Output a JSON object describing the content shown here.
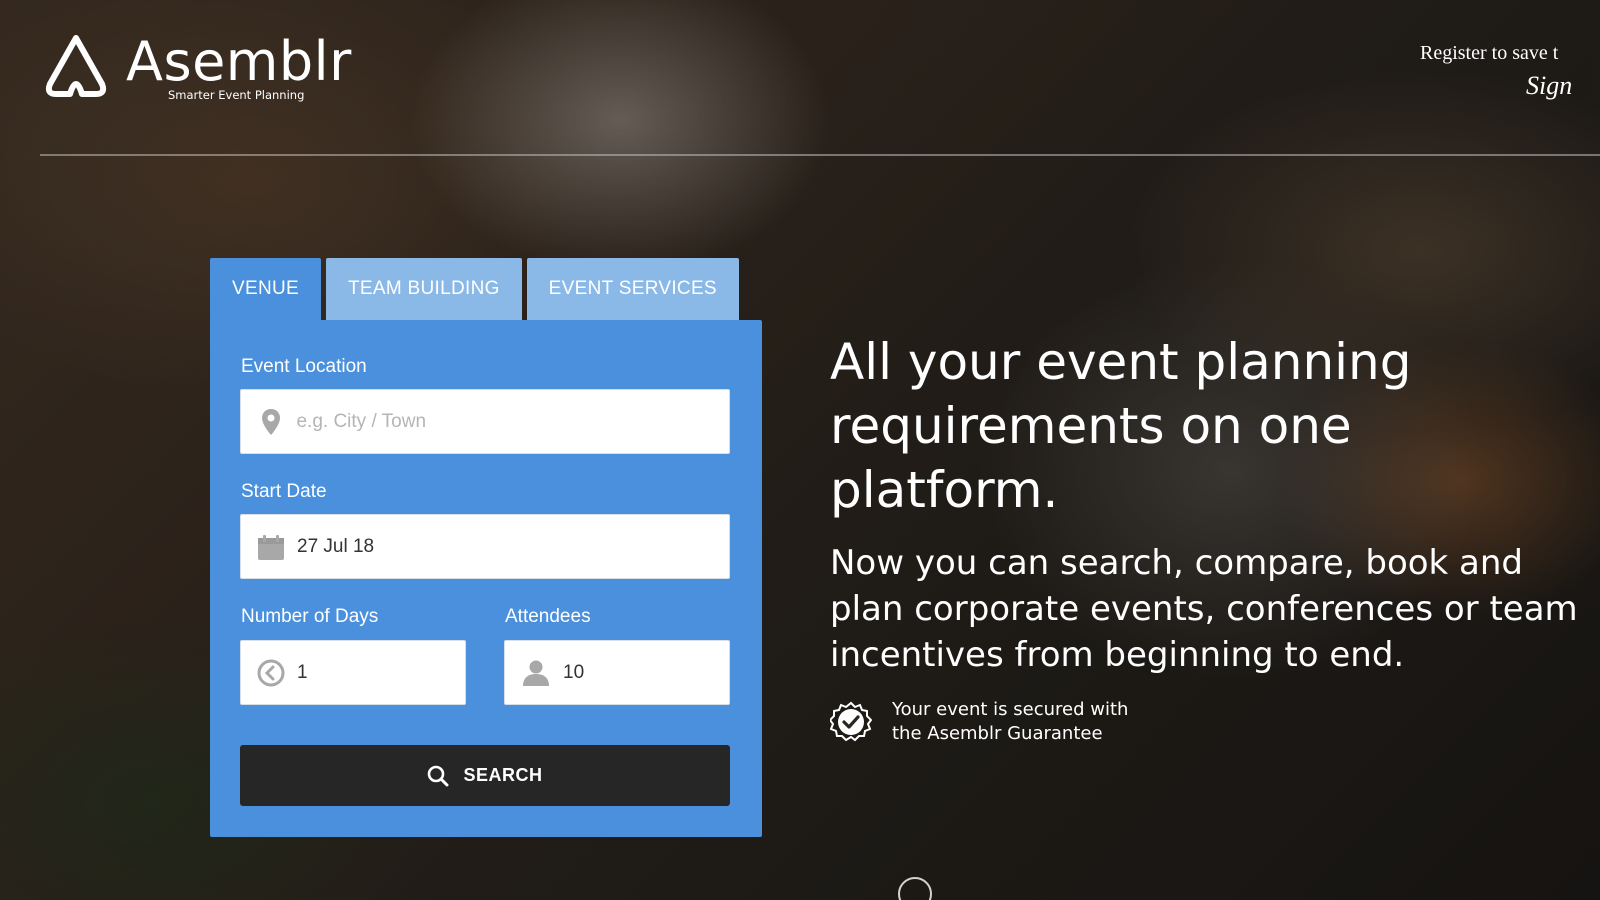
{
  "brand": {
    "name": "Asemblr",
    "tagline": "Smarter Event Planning"
  },
  "header": {
    "register_text": "Register to save t",
    "signin_label": "Sign"
  },
  "tabs": [
    {
      "label": "VENUE",
      "active": true
    },
    {
      "label": "TEAM BUILDING",
      "active": false
    },
    {
      "label": "EVENT SERVICES",
      "active": false
    }
  ],
  "form": {
    "location": {
      "label": "Event Location",
      "placeholder": "e.g. City / Town",
      "value": "",
      "icon": "map-pin-icon"
    },
    "start_date": {
      "label": "Start Date",
      "value": "27 Jul 18",
      "icon": "calendar-icon"
    },
    "days": {
      "label": "Number of Days",
      "value": "1",
      "icon": "clock-icon"
    },
    "attendees": {
      "label": "Attendees",
      "value": "10",
      "icon": "person-icon"
    },
    "search_label": "SEARCH"
  },
  "hero": {
    "title": "All your event planning requirements on one platform.",
    "subtitle": "Now you can search, compare, book and plan corporate events, conferences or team incentives from beginning to end.",
    "guarantee": "Your event is secured with the Asemblr Guarantee"
  },
  "colors": {
    "panel": "#4a90dd",
    "tab_inactive": "#8ab9e8",
    "search_button": "#262626"
  }
}
